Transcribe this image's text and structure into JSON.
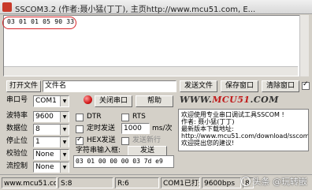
{
  "window": {
    "title": "SSCOM3.2 (作者:聂小猛(丁丁), 主页http://www.mcu51.com, E..."
  },
  "receive": {
    "text": "03 01 01 05 90 33"
  },
  "file_row": {
    "open_file": "打开文件",
    "file_name": "文件名",
    "send_file": "发送文件",
    "save_window": "保存窗口",
    "clear_window": "清除窗口"
  },
  "port_row": {
    "port_label": "串口号",
    "port_value": "COM1",
    "close_port": "关闭串口",
    "help": "帮助",
    "banner_pre": "WWW.",
    "banner_brand": "MCU51",
    "banner_post": ".COM"
  },
  "settings": {
    "baud_label": "波特率",
    "baud_value": "9600",
    "data_label": "数据位",
    "data_value": "8",
    "stop_label": "停止位",
    "stop_value": "1",
    "parity_label": "校验位",
    "parity_value": "None",
    "flow_label": "流控制",
    "flow_value": "None"
  },
  "options": {
    "dtr": "DTR",
    "rts": "RTS",
    "timed_send": "定时发送",
    "interval": "1000",
    "interval_unit": "ms/次",
    "hex_send": "HEX发送",
    "send_newline": "发送新行",
    "input_label": "字符串输入框:",
    "send": "发送",
    "send_value": "03 01 00 00 00 03 7d e9"
  },
  "info_box": {
    "line1": "欢迎使用专业串口调试工具SSCOM !",
    "line2": "作者: 聂小猛(丁丁)",
    "line3": "最新版本下载地址:",
    "line4": "http://www.mcu51.com/download/sscom",
    "line5": "欢迎提出您的建议!"
  },
  "status_bar": {
    "site": "www.mcu51.cor",
    "s": "S:8",
    "r": "R:6",
    "port_state": "COM1已打开",
    "baud": "9600bps",
    "extra": "8",
    "watermark": "头条 @玩转嵌"
  }
}
